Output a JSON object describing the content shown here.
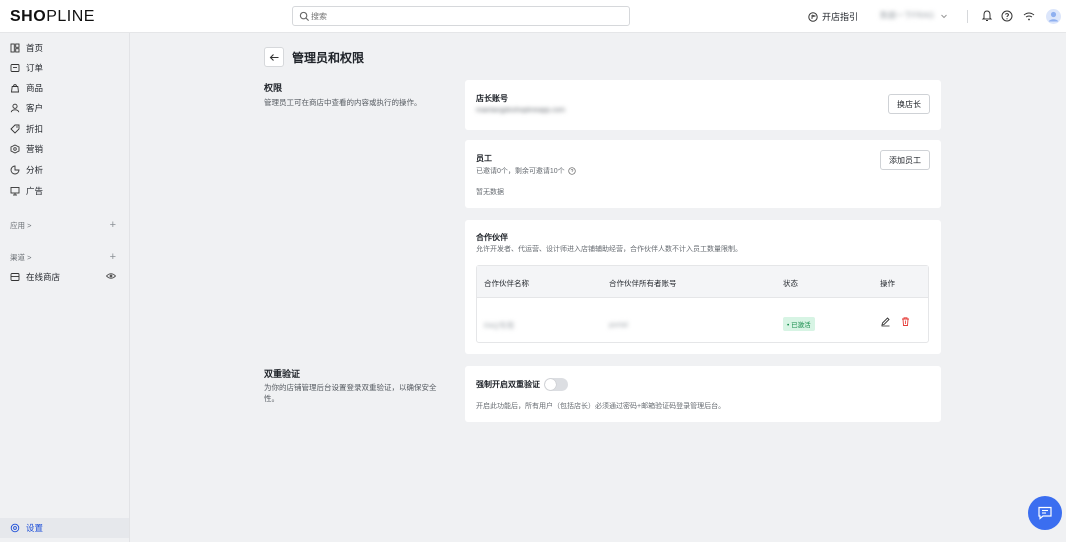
{
  "topbar": {
    "logo_bold": "SH",
    "logo_o": "O",
    "logo_rest": "PLINE",
    "search_placeholder": "搜索",
    "guide_label": "开店指引",
    "store_name": "数据一下FRAG"
  },
  "sidebar": {
    "items": [
      {
        "label": "首页",
        "icon": "home-icon"
      },
      {
        "label": "订单",
        "icon": "order-icon"
      },
      {
        "label": "商品",
        "icon": "bag-icon"
      },
      {
        "label": "客户",
        "icon": "user-icon"
      },
      {
        "label": "折扣",
        "icon": "tag-icon"
      },
      {
        "label": "营销",
        "icon": "marketing-icon"
      },
      {
        "label": "分析",
        "icon": "chart-icon"
      },
      {
        "label": "广告",
        "icon": "ad-icon"
      }
    ],
    "apps_label": "应用 >",
    "channels_label": "渠道 >",
    "online_store_label": "在线商店",
    "settings_label": "设置"
  },
  "page": {
    "title": "管理员和权限",
    "permissions": {
      "title": "权限",
      "desc": "管理员工可在商店中查看的内容或执行的操作。"
    },
    "owner_card": {
      "title": "店长账号",
      "email": "mainlangdoshoplineapp.com",
      "button": "换店长"
    },
    "staff_card": {
      "title": "员工",
      "sub": "已邀请0个，剩余可邀请10个",
      "empty": "暂无数据",
      "button": "添加员工"
    },
    "partner_card": {
      "title": "合作伙伴",
      "sub": "允许开发者、代运营、设计师进入店铺辅助经营，合作伙伴人数不计入员工数量限制。",
      "columns": [
        "合作伙伴名称",
        "合作伙伴所有者账号",
        "状态",
        "操作"
      ],
      "row": {
        "name": "FAQ专用",
        "account": "portal",
        "status": "• 已激活"
      }
    },
    "twofa": {
      "title": "双重验证",
      "desc": "为你的店铺管理后台设置登录双重验证，以确保安全性。",
      "toggle_label": "强制开启双重验证",
      "toggle_on": false,
      "note": "开启此功能后，所有用户（包括店长）必须通过密码+邮箱验证码登录管理后台。"
    }
  },
  "colors": {
    "accent": "#3b6ef0",
    "active_badge_bg": "#d7f4e4",
    "active_badge_text": "#128a48",
    "delete_red": "#e53935"
  }
}
